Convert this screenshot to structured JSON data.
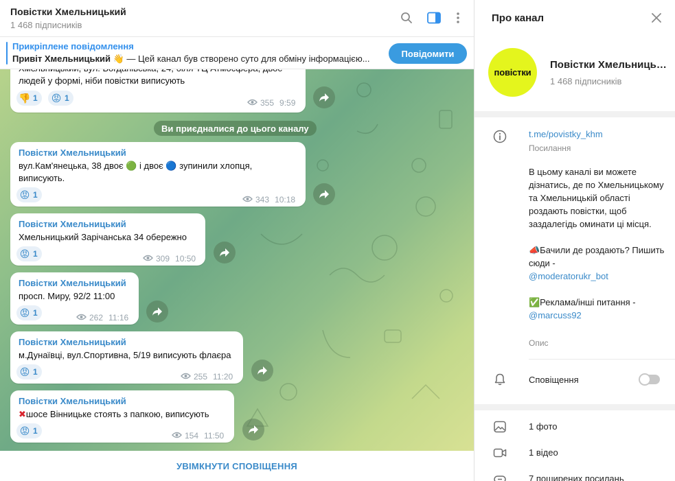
{
  "chat": {
    "title": "Повістки Хмельницький",
    "subscribers": "1 468 підписників"
  },
  "pinned": {
    "label": "Прикріплене повідомлення",
    "bold": "Привіт Хмельницький 👋",
    "text": " — Цей канал був створено суто для обміну інформацією...",
    "report_button": "Повідомити"
  },
  "first_message": {
    "text_line1": "Хмельницький, вул. Богданівська, 24, біля ТЦ Атмосфера, двоє",
    "text_line2": "людей у формі, ніби повістки виписують",
    "reaction1_count": "1",
    "reaction2_count": "1",
    "views": "355",
    "time": "9:59"
  },
  "joined_notice": "Ви приєдналися до цього каналу",
  "messages": [
    {
      "author": "Повістки Хмельницький",
      "text_line1": "вул.Кам'янецька, 38 двоє 🟢 і двоє 🔵 зупинили хлопця,",
      "text_line2": "виписують.",
      "reaction_count": "1",
      "views": "343",
      "time": "10:18"
    },
    {
      "author": "Повістки Хмельницький",
      "text_line1": "Хмельницький Зарічанська 34 обережно",
      "reaction_count": "1",
      "views": "309",
      "time": "10:50"
    },
    {
      "author": "Повістки Хмельницький",
      "text_line1": "просп. Миру, 92/2 11:00",
      "reaction_count": "1",
      "views": "262",
      "time": "11:16"
    },
    {
      "author": "Повістки Хмельницький",
      "text_line1": "м.Дунаївці, вул.Спортивна, 5/19 виписують флаєра",
      "reaction_count": "1",
      "views": "255",
      "time": "11:20"
    },
    {
      "author": "Повістки Хмельницький",
      "text_line1": "шосе Вінницьке стоять з папкою, виписують",
      "reaction_count": "1",
      "views": "154",
      "time": "11:50"
    }
  ],
  "bottom_action": "УВІМКНУТИ СПОВІЩЕННЯ",
  "info_panel": {
    "title": "Про канал",
    "avatar_text": "повістки",
    "channel_name": "Повістки Хмельницький",
    "subscribers": "1 468 підписників",
    "link": "t.me/povistky_khm",
    "link_caption": "Посилання",
    "desc_p1": "В цьому каналі ви можете дізнатись, де по Хмельницькому та Хмельницькій області роздають повістки, щоб заздалегідь оминати ці місця.",
    "desc_p2a": "📣Бачили де роздають? Пишить сюди -",
    "desc_p2_link": "@moderatorukr_bot",
    "desc_p3a": "✅Реклама/інші питання -",
    "desc_p3_link": "@marcuss92",
    "desc_caption": "Опис",
    "notifications_label": "Сповіщення",
    "notifications_on": false,
    "media": [
      {
        "icon": "photo-icon",
        "label": "1 фото"
      },
      {
        "icon": "video-icon",
        "label": "1 відео"
      },
      {
        "icon": "link-icon",
        "label": "7 поширених посилань"
      }
    ]
  },
  "colors": {
    "accent": "#3390ec",
    "link": "#3a8ac9",
    "button": "#3a9be0",
    "avatar": "#e4f51d"
  }
}
